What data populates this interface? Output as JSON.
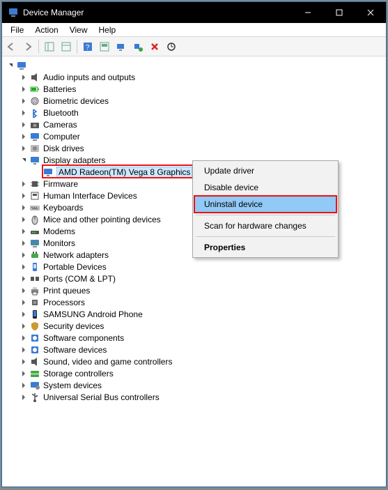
{
  "window": {
    "title": "Device Manager"
  },
  "menubar": [
    "File",
    "Action",
    "View",
    "Help"
  ],
  "tree": {
    "root_open": true,
    "categories": [
      {
        "label": "Audio inputs and outputs",
        "icon": "speaker",
        "expandable": true
      },
      {
        "label": "Batteries",
        "icon": "battery",
        "expandable": true
      },
      {
        "label": "Biometric devices",
        "icon": "fingerprint",
        "expandable": true
      },
      {
        "label": "Bluetooth",
        "icon": "bluetooth",
        "expandable": true
      },
      {
        "label": "Cameras",
        "icon": "camera",
        "expandable": true
      },
      {
        "label": "Computer",
        "icon": "computer",
        "expandable": true
      },
      {
        "label": "Disk drives",
        "icon": "disk",
        "expandable": true
      },
      {
        "label": "Display adapters",
        "icon": "display",
        "expandable": true,
        "open": true,
        "children": [
          {
            "label": "AMD Radeon(TM) Vega 8 Graphics",
            "icon": "display",
            "selected": true,
            "highlighted_red": true
          }
        ]
      },
      {
        "label": "Firmware",
        "icon": "chip",
        "expandable": true
      },
      {
        "label": "Human Interface Devices",
        "icon": "hid",
        "expandable": true
      },
      {
        "label": "Keyboards",
        "icon": "keyboard",
        "expandable": true
      },
      {
        "label": "Mice and other pointing devices",
        "icon": "mouse",
        "expandable": true
      },
      {
        "label": "Modems",
        "icon": "modem",
        "expandable": true
      },
      {
        "label": "Monitors",
        "icon": "monitor",
        "expandable": true
      },
      {
        "label": "Network adapters",
        "icon": "network",
        "expandable": true
      },
      {
        "label": "Portable Devices",
        "icon": "portable",
        "expandable": true
      },
      {
        "label": "Ports (COM & LPT)",
        "icon": "ports",
        "expandable": true
      },
      {
        "label": "Print queues",
        "icon": "printer",
        "expandable": true
      },
      {
        "label": "Processors",
        "icon": "cpu",
        "expandable": true
      },
      {
        "label": "SAMSUNG Android Phone",
        "icon": "phone",
        "expandable": true
      },
      {
        "label": "Security devices",
        "icon": "security",
        "expandable": true
      },
      {
        "label": "Software components",
        "icon": "software",
        "expandable": true
      },
      {
        "label": "Software devices",
        "icon": "software",
        "expandable": true
      },
      {
        "label": "Sound, video and game controllers",
        "icon": "speaker",
        "expandable": true
      },
      {
        "label": "Storage controllers",
        "icon": "storage",
        "expandable": true
      },
      {
        "label": "System devices",
        "icon": "system",
        "expandable": true
      },
      {
        "label": "Universal Serial Bus controllers",
        "icon": "usb",
        "expandable": true
      }
    ]
  },
  "context_menu": {
    "items": [
      {
        "label": "Update driver"
      },
      {
        "label": "Disable device"
      },
      {
        "label": "Uninstall device",
        "highlighted": true,
        "highlighted_red": true
      },
      {
        "sep": true
      },
      {
        "label": "Scan for hardware changes"
      },
      {
        "sep": true
      },
      {
        "label": "Properties",
        "bold": true
      }
    ]
  }
}
